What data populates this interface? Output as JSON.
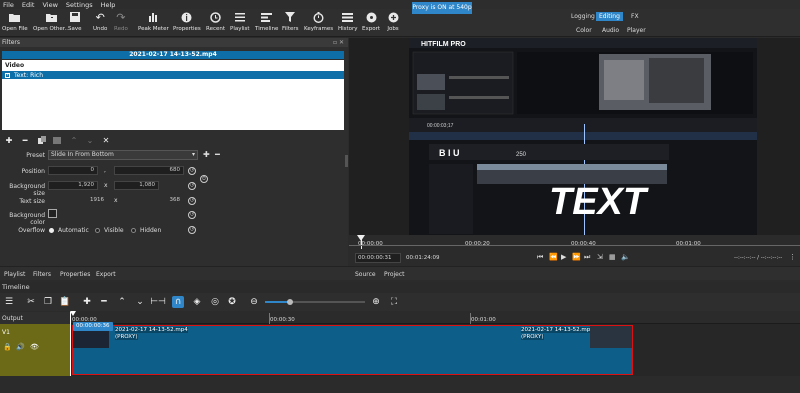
{
  "menu": [
    "File",
    "Edit",
    "View",
    "Settings",
    "Help"
  ],
  "toolbar": [
    {
      "label": "Open File",
      "icon": "folder-open-icon",
      "dim": false
    },
    {
      "label": "Open Other...",
      "icon": "folder-plus-icon",
      "dim": false
    },
    {
      "label": "Save",
      "icon": "save-icon",
      "dim": false
    },
    {
      "label": "Undo",
      "icon": "undo-icon",
      "dim": false
    },
    {
      "label": "Redo",
      "icon": "redo-icon",
      "dim": true
    },
    {
      "label": "Peak Meter",
      "icon": "meter-icon",
      "dim": false
    },
    {
      "label": "Properties",
      "icon": "info-icon",
      "dim": false
    },
    {
      "label": "Recent",
      "icon": "clock-icon",
      "dim": false
    },
    {
      "label": "Playlist",
      "icon": "list-icon",
      "dim": false
    },
    {
      "label": "Timeline",
      "icon": "timeline-icon",
      "dim": false
    },
    {
      "label": "Filters",
      "icon": "funnel-icon",
      "dim": false
    },
    {
      "label": "Keyframes",
      "icon": "stopwatch-icon",
      "dim": false
    },
    {
      "label": "History",
      "icon": "history-icon",
      "dim": false
    },
    {
      "label": "Export",
      "icon": "disc-icon",
      "dim": false
    },
    {
      "label": "Jobs",
      "icon": "jobs-icon",
      "dim": false
    }
  ],
  "layouts": {
    "row1": [
      "Logging",
      "Editing",
      "FX"
    ],
    "row2": [
      "Color",
      "Audio",
      "Player"
    ],
    "active": "Editing"
  },
  "filters": {
    "title": "Filters",
    "clip_name": "2021-02-17 14-13-52.mp4",
    "section": "Video",
    "items": [
      {
        "label": "Text: Rich",
        "checked": true
      }
    ],
    "preset_label": "Preset",
    "preset_value": "Slide In From Bottom",
    "props": {
      "position_label": "Position",
      "position_x": "0",
      "position_sep": ",",
      "position_y": "680",
      "bgsize_label": "Background size",
      "bgsize_w": "1,920",
      "bgsize_sep": "x",
      "bgsize_h": "1,080",
      "textsize_label": "Text size",
      "textsize_w": "1916",
      "textsize_sep": "x",
      "textsize_h": "368",
      "bgcolor_label": "Background color",
      "overflow_label": "Overflow",
      "overflow_options": [
        "Automatic",
        "Visible",
        "Hidden"
      ],
      "overflow_selected": "Automatic"
    }
  },
  "preview": {
    "big_text": "TEXT",
    "inner_time": "00:00:03;17",
    "inner_font_size": "250",
    "scrub_ticks": [
      "00:00:00",
      "00:00:20",
      "00:00:40",
      "00:01:00"
    ],
    "position": "00:00:00:31",
    "duration": "00:01:24:09",
    "in_out": "--:--:--:-- / --:--:--:--"
  },
  "left_tabs": [
    "Playlist",
    "Filters",
    "Properties",
    "Export"
  ],
  "right_tabs": [
    "Source",
    "Project"
  ],
  "proxy_tab": "Proxy is ON at 540p",
  "timeline": {
    "title": "Timeline",
    "output_label": "Output",
    "track_name": "V1",
    "ruler": [
      "00:00:00",
      "00:00:30",
      "00:01:00"
    ],
    "playhead_time": "00:00:00:36",
    "clips": [
      {
        "name": "2021-02-17 14-13-52.mp4",
        "tag": "(PROXY)"
      },
      {
        "name": "2021-02-17 14-13-52.mp4",
        "tag": "(PROXY)"
      }
    ]
  },
  "colors": {
    "accent": "#2f86c9",
    "selection": "#0e6fa8",
    "track_head": "#6c6a17",
    "clip_border": "#dd1111"
  }
}
